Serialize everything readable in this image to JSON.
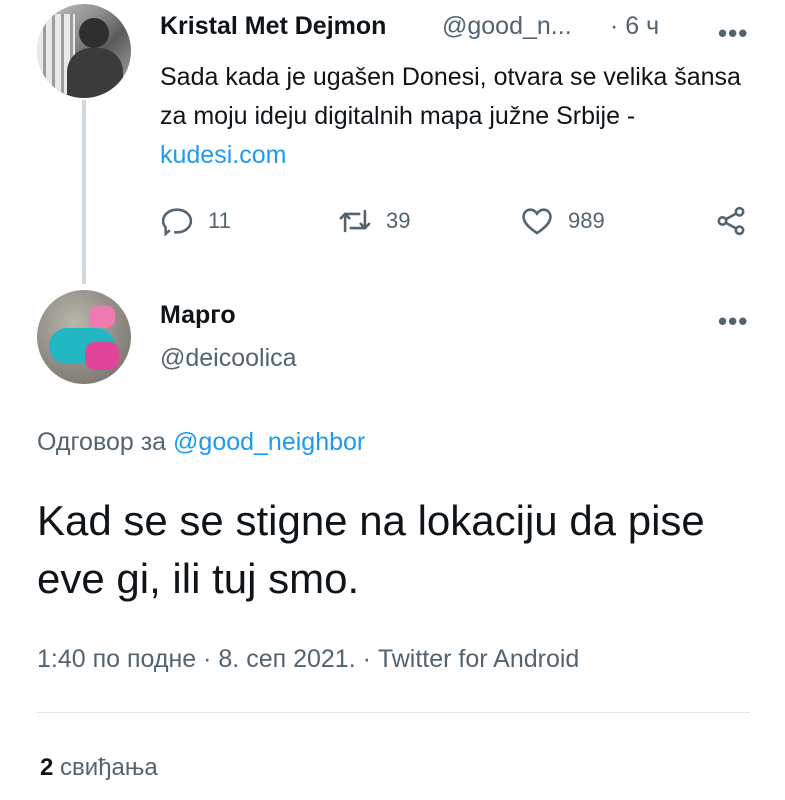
{
  "parent_tweet": {
    "author_name": "Kristal Met Dejmon",
    "handle": "@good_n...",
    "time": "· 6 ч",
    "text_plain": "Sada kada je ugašen Donesi, otvara se velika šansa za moju ideju digitalnih mapa južne Srbije - ",
    "text_link": "kudesi.com",
    "actions": {
      "replies": "11",
      "retweets": "39",
      "likes": "989"
    },
    "more_icon": "more-dots-icon"
  },
  "reply_tweet": {
    "author_name": "Марго",
    "handle": "@deicoolica",
    "reply_to_label": "Одговор за ",
    "reply_to_handle": "@good_neighbor",
    "text": "Kad se se stigne na lokaciju da pise eve gi, ili tuj smo.",
    "meta": "1:40 по подне · 8. сеп 2021. · Twitter for Android",
    "likes_count": "2",
    "likes_label": "свиђања",
    "more_icon": "more-dots-icon"
  },
  "colors": {
    "link": "#1d9bf0",
    "secondary_text": "#536471",
    "primary_text": "#0f1419",
    "thread_line": "#cfd9de"
  }
}
